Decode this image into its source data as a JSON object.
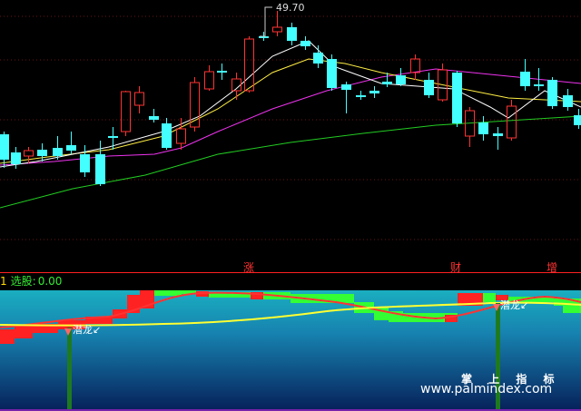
{
  "price_chart": {
    "peak_label": "49.70",
    "event_markers": [
      {
        "name": "event-marker-zhang",
        "label": "涨"
      },
      {
        "name": "event-marker-cai",
        "label": "财"
      },
      {
        "name": "event-marker-zeng",
        "label": "增"
      }
    ]
  },
  "indicator_panel": {
    "index_label": "1",
    "selector_label": "选股:",
    "selector_value": "0.00",
    "signal_label": "潜龙↙"
  },
  "watermark": {
    "title": "掌 上 指 标",
    "url": "www.palmindex.com"
  },
  "colors": {
    "background": "#000000",
    "up_candle": "#ff3333",
    "down_candle": "#44ffff",
    "ma_fast": "#ffffff",
    "ma_mid": "#ffee44",
    "ma_slow": "#ee33ee",
    "ma_long": "#22cc22",
    "panel_top": "#1aaec0",
    "panel_bottom": "#06205a"
  }
}
